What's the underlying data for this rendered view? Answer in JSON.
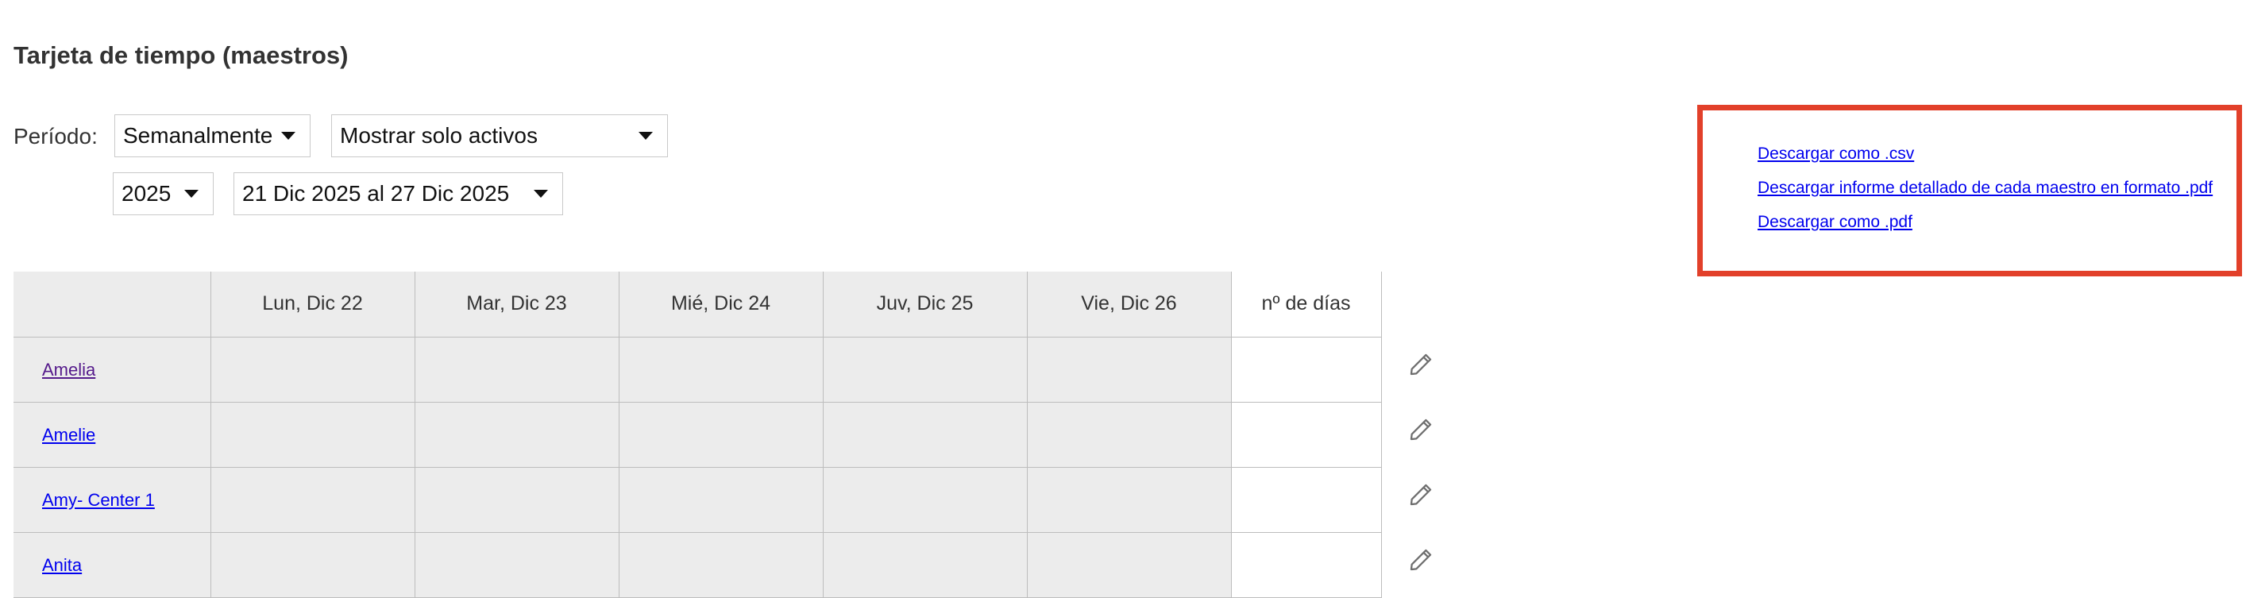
{
  "page": {
    "title": "Tarjeta de tiempo (maestros)"
  },
  "filters": {
    "period_label": "Período:",
    "frequency": "Semanalmente",
    "status": "Mostrar solo activos",
    "year": "2025",
    "week_range": "21 Dic 2025 al 27 Dic 2025"
  },
  "downloads": {
    "csv": "Descargar como .csv",
    "detailed_pdf": "Descargar informe detallado de cada maestro en formato .pdf",
    "pdf": "Descargar como .pdf",
    "highlight_color": "#e2402a"
  },
  "table": {
    "columns": [
      "",
      "Lun, Dic 22",
      "Mar, Dic 23",
      "Mié, Dic 24",
      "Juv, Dic 25",
      "Vie, Dic 26",
      "nº de días"
    ],
    "rows": [
      {
        "name": "Amelia",
        "visited": true
      },
      {
        "name": "Amelie",
        "visited": false
      },
      {
        "name": "Amy- Center 1",
        "visited": false
      },
      {
        "name": "Anita",
        "visited": false
      }
    ],
    "row_action_icon": "pencil-icon"
  }
}
